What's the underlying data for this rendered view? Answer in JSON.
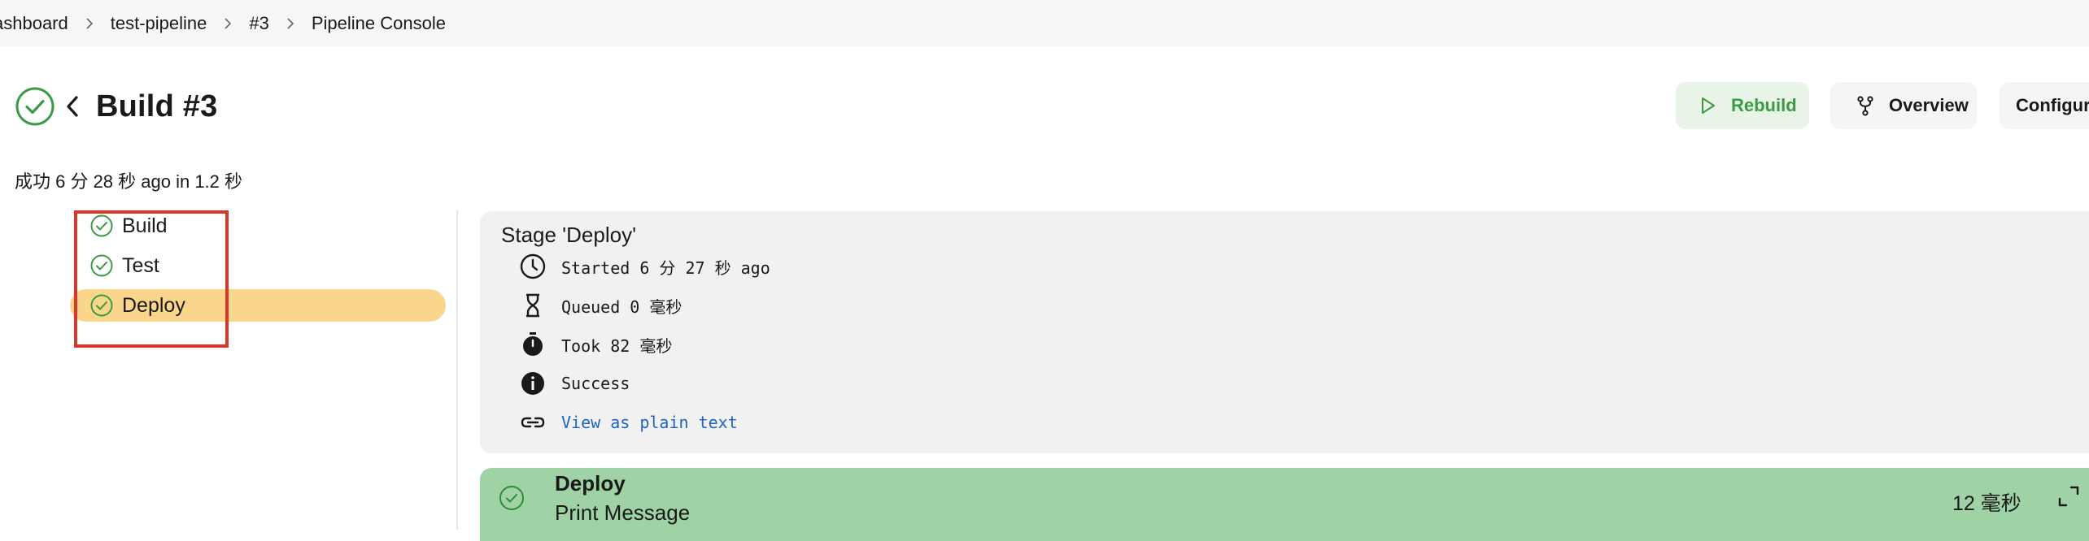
{
  "breadcrumb": {
    "items": [
      "ashboard",
      "test-pipeline",
      "#3",
      "Pipeline Console"
    ]
  },
  "header": {
    "title": "Build #3",
    "summary": "成功 6 分 28 秒 ago in 1.2 秒",
    "actions": {
      "rebuild": "Rebuild",
      "overview": "Overview",
      "configure": "Configure"
    }
  },
  "stages": [
    {
      "label": "Build",
      "status": "success"
    },
    {
      "label": "Test",
      "status": "success"
    },
    {
      "label": "Deploy",
      "status": "success",
      "selected": true
    }
  ],
  "stage_details": {
    "title": "Stage 'Deploy'",
    "started": "Started 6 分 27 秒 ago",
    "queued": "Queued 0 毫秒",
    "took": "Took 82 毫秒",
    "status": "Success",
    "plain_text_link": "View as plain text"
  },
  "step": {
    "name": "Deploy",
    "description": "Print Message",
    "duration": "12 毫秒"
  },
  "colors": {
    "success": "#3c9a44",
    "selected_stage": "#fad68c",
    "step_success_bg": "#9fd2a5",
    "link": "#2063c6",
    "highlight_border": "#d9372a"
  },
  "icons": {
    "success": "check-circle-icon",
    "back": "chevron-left-icon",
    "rebuild": "play-icon",
    "overview": "branch-icon",
    "started": "clock-icon",
    "queued": "hourglass-icon",
    "took": "stopwatch-icon",
    "status": "info-icon",
    "link": "link-icon",
    "expand": "expand-icon"
  }
}
